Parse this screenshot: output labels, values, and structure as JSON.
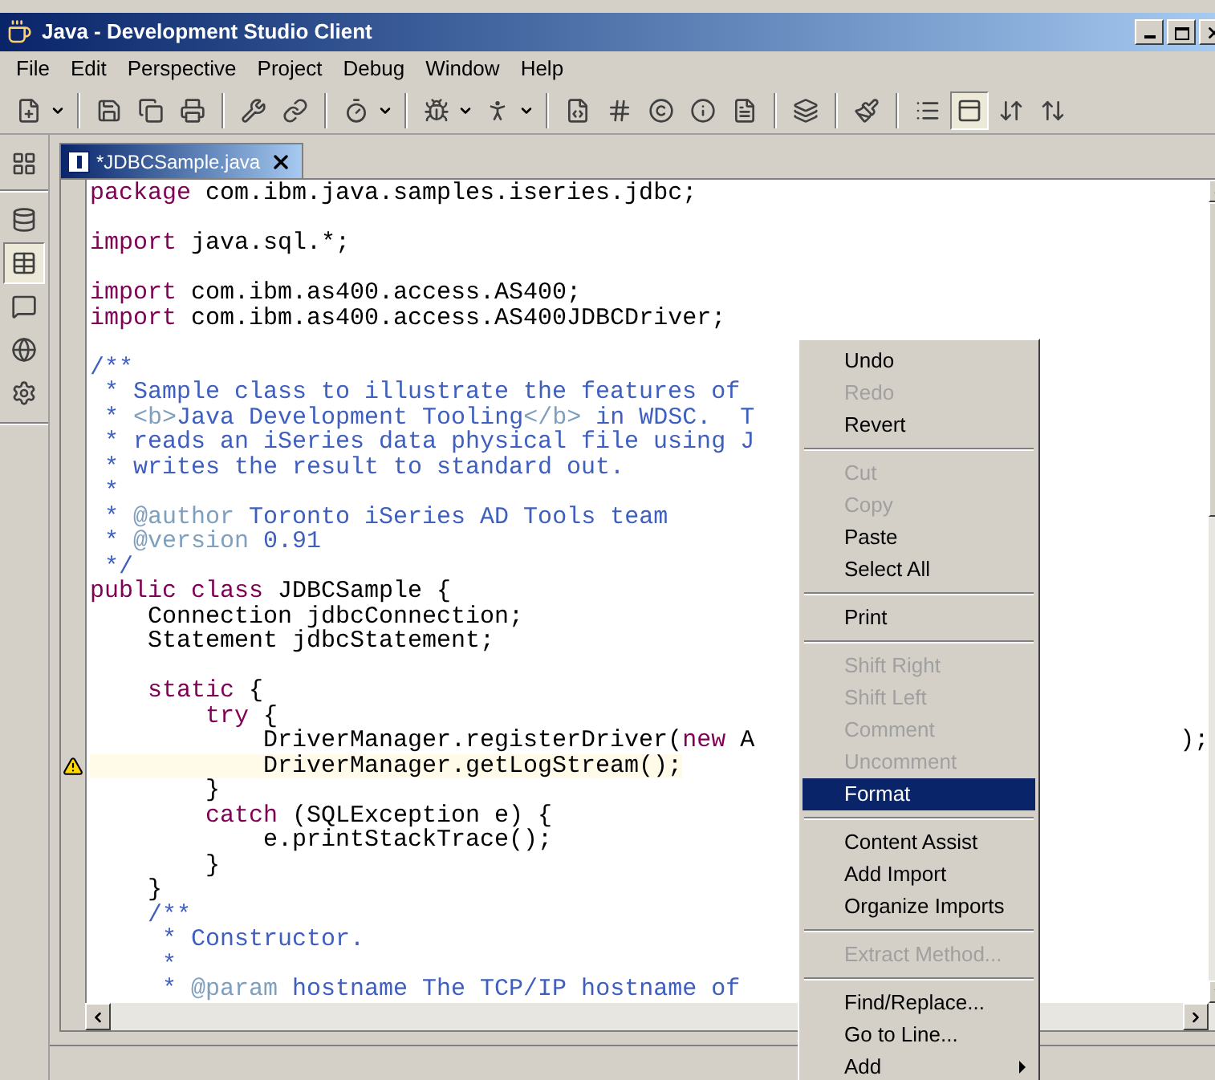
{
  "window": {
    "title": "Java - Development Studio Client"
  },
  "menubar": [
    "File",
    "Edit",
    "Perspective",
    "Project",
    "Debug",
    "Window",
    "Help"
  ],
  "toolbar": [
    {
      "kind": "dropdown",
      "pressed": false
    },
    {
      "kind": "separator"
    },
    {
      "kind": "button",
      "pressed": false
    },
    {
      "kind": "button",
      "pressed": false
    },
    {
      "kind": "button",
      "pressed": false
    },
    {
      "kind": "separator"
    },
    {
      "kind": "button",
      "pressed": false
    },
    {
      "kind": "button",
      "pressed": false
    },
    {
      "kind": "separator"
    },
    {
      "kind": "dropdown",
      "pressed": false
    },
    {
      "kind": "separator"
    },
    {
      "kind": "dropdown",
      "pressed": false
    },
    {
      "kind": "dropdown",
      "pressed": false
    },
    {
      "kind": "separator"
    },
    {
      "kind": "button",
      "pressed": false
    },
    {
      "kind": "button",
      "pressed": false
    },
    {
      "kind": "button",
      "pressed": false
    },
    {
      "kind": "button",
      "pressed": false
    },
    {
      "kind": "button",
      "pressed": false
    },
    {
      "kind": "separator"
    },
    {
      "kind": "button",
      "pressed": false
    },
    {
      "kind": "separator"
    },
    {
      "kind": "button",
      "pressed": false
    },
    {
      "kind": "separator"
    },
    {
      "kind": "button",
      "pressed": false
    },
    {
      "kind": "button",
      "pressed": true
    },
    {
      "kind": "button",
      "pressed": false
    },
    {
      "kind": "button",
      "pressed": false
    }
  ],
  "side_toolbar": [
    {
      "pressed": false
    },
    {
      "pressed": true
    },
    {
      "pressed": false
    },
    {
      "pressed": false
    },
    {
      "pressed": false
    }
  ],
  "editor_tab": {
    "label": "*JDBCSample.java",
    "selected": true
  },
  "code_lines": [
    {
      "warning": false,
      "tokens": [
        {
          "kind": "keyword",
          "text": "package"
        },
        {
          "kind": "plain",
          "text": " com.ibm.java.samples.iseries.jdbc;"
        }
      ]
    },
    {
      "kind": "blank"
    },
    {
      "warning": false,
      "tokens": [
        {
          "kind": "keyword",
          "text": "import"
        },
        {
          "kind": "plain",
          "text": " java.sql.*;"
        }
      ]
    },
    {
      "kind": "blank"
    },
    {
      "warning": false,
      "tokens": [
        {
          "kind": "keyword",
          "text": "import"
        },
        {
          "kind": "plain",
          "text": " com.ibm.as400.access.AS400;"
        }
      ]
    },
    {
      "warning": false,
      "tokens": [
        {
          "kind": "keyword",
          "text": "import"
        },
        {
          "kind": "plain",
          "text": " com.ibm.as400.access.AS400JDBCDriver;"
        }
      ]
    },
    {
      "kind": "blank"
    },
    {
      "warning": false,
      "tokens": [
        {
          "kind": "comment",
          "text": "/**"
        }
      ]
    },
    {
      "warning": false,
      "tokens": [
        {
          "kind": "comment",
          "text": " * Sample class to illustrate the features of"
        }
      ]
    },
    {
      "warning": false,
      "tokens": [
        {
          "kind": "comment",
          "text": " * "
        },
        {
          "kind": "doctag",
          "text": "<b>"
        },
        {
          "kind": "comment",
          "text": "Java Development Tooling"
        },
        {
          "kind": "doctag",
          "text": "</b>"
        },
        {
          "kind": "comment",
          "text": " in WDSC.  T"
        }
      ]
    },
    {
      "warning": false,
      "tokens": [
        {
          "kind": "comment",
          "text": " * reads an iSeries data physical file using J"
        }
      ]
    },
    {
      "warning": false,
      "tokens": [
        {
          "kind": "comment",
          "text": " * writes the result to standard out."
        }
      ]
    },
    {
      "warning": false,
      "tokens": [
        {
          "kind": "comment",
          "text": " *"
        }
      ]
    },
    {
      "warning": false,
      "tokens": [
        {
          "kind": "comment",
          "text": " * "
        },
        {
          "kind": "doctag",
          "text": "@author"
        },
        {
          "kind": "comment",
          "text": " Toronto iSeries AD Tools team"
        }
      ]
    },
    {
      "warning": false,
      "tokens": [
        {
          "kind": "comment",
          "text": " * "
        },
        {
          "kind": "doctag",
          "text": "@version"
        },
        {
          "kind": "comment",
          "text": " 0.91"
        }
      ]
    },
    {
      "warning": false,
      "tokens": [
        {
          "kind": "comment",
          "text": " */"
        }
      ]
    },
    {
      "warning": false,
      "tokens": [
        {
          "kind": "keyword",
          "text": "public class"
        },
        {
          "kind": "plain",
          "text": " JDBCSample {"
        }
      ]
    },
    {
      "warning": false,
      "tokens": [
        {
          "kind": "plain",
          "text": "    Connection jdbcConnection;"
        }
      ]
    },
    {
      "warning": false,
      "tokens": [
        {
          "kind": "plain",
          "text": "    Statement jdbcStatement;"
        }
      ]
    },
    {
      "kind": "blank"
    },
    {
      "warning": false,
      "tokens": [
        {
          "kind": "keyword",
          "text": "    static"
        },
        {
          "kind": "plain",
          "text": " {"
        }
      ]
    },
    {
      "warning": false,
      "tokens": [
        {
          "kind": "keyword",
          "text": "        try"
        },
        {
          "kind": "plain",
          "text": " {"
        }
      ]
    },
    {
      "warning": false,
      "tokens": [
        {
          "kind": "plain",
          "text": "            DriverManager.registerDriver("
        },
        {
          "kind": "keyword",
          "text": "new"
        },
        {
          "kind": "plain",
          "text": " A"
        },
        {
          "kind": "covered"
        },
        {
          "kind": "plain",
          "text": ");"
        }
      ]
    },
    {
      "warning": true,
      "tokens": [
        {
          "kind": "plain",
          "text": "            DriverManager.getLogStream();"
        }
      ]
    },
    {
      "warning": false,
      "tokens": [
        {
          "kind": "plain",
          "text": "        }"
        }
      ]
    },
    {
      "warning": false,
      "tokens": [
        {
          "kind": "keyword",
          "text": "        catch"
        },
        {
          "kind": "plain",
          "text": " (SQLException e) {"
        }
      ]
    },
    {
      "warning": false,
      "tokens": [
        {
          "kind": "plain",
          "text": "            e.printStackTrace();"
        }
      ]
    },
    {
      "warning": false,
      "tokens": [
        {
          "kind": "plain",
          "text": "        }"
        }
      ]
    },
    {
      "warning": false,
      "tokens": [
        {
          "kind": "plain",
          "text": "    }"
        }
      ]
    },
    {
      "warning": false,
      "tokens": [
        {
          "kind": "comment",
          "text": "    /**"
        }
      ]
    },
    {
      "warning": false,
      "tokens": [
        {
          "kind": "comment",
          "text": "     * Constructor."
        }
      ]
    },
    {
      "warning": false,
      "tokens": [
        {
          "kind": "comment",
          "text": "     *"
        }
      ]
    },
    {
      "warning": false,
      "tokens": [
        {
          "kind": "comment",
          "text": "     * "
        },
        {
          "kind": "doctag",
          "text": "@param"
        },
        {
          "kind": "comment",
          "text": " hostname The TCP/IP hostname of"
        }
      ]
    }
  ],
  "context_menu": [
    {
      "kind": "item",
      "label": "Undo",
      "disabled": false,
      "selected": false
    },
    {
      "kind": "item",
      "label": "Redo",
      "disabled": true,
      "selected": false
    },
    {
      "kind": "item",
      "label": "Revert",
      "disabled": false,
      "selected": false
    },
    {
      "kind": "separator"
    },
    {
      "kind": "item",
      "label": "Cut",
      "disabled": true,
      "selected": false
    },
    {
      "kind": "item",
      "label": "Copy",
      "disabled": true,
      "selected": false
    },
    {
      "kind": "item",
      "label": "Paste",
      "disabled": false,
      "selected": false
    },
    {
      "kind": "item",
      "label": "Select All",
      "disabled": false,
      "selected": false
    },
    {
      "kind": "separator"
    },
    {
      "kind": "item",
      "label": "Print",
      "disabled": false,
      "selected": false
    },
    {
      "kind": "separator"
    },
    {
      "kind": "item",
      "label": "Shift Right",
      "disabled": true,
      "selected": false
    },
    {
      "kind": "item",
      "label": "Shift Left",
      "disabled": true,
      "selected": false
    },
    {
      "kind": "item",
      "label": "Comment",
      "disabled": true,
      "selected": false
    },
    {
      "kind": "item",
      "label": "Uncomment",
      "disabled": true,
      "selected": false
    },
    {
      "kind": "item",
      "label": "Format",
      "disabled": false,
      "selected": true
    },
    {
      "kind": "separator"
    },
    {
      "kind": "item",
      "label": "Content Assist",
      "disabled": false,
      "selected": false
    },
    {
      "kind": "item",
      "label": "Add Import",
      "disabled": false,
      "selected": false
    },
    {
      "kind": "item",
      "label": "Organize Imports",
      "disabled": false,
      "selected": false
    },
    {
      "kind": "separator"
    },
    {
      "kind": "item",
      "label": "Extract Method...",
      "disabled": true,
      "selected": false
    },
    {
      "kind": "separator"
    },
    {
      "kind": "item",
      "label": "Find/Replace...",
      "disabled": false,
      "selected": false
    },
    {
      "kind": "item",
      "label": "Go to Line...",
      "disabled": false,
      "selected": false
    },
    {
      "kind": "submenu",
      "label": "Add",
      "disabled": false,
      "selected": false
    }
  ]
}
